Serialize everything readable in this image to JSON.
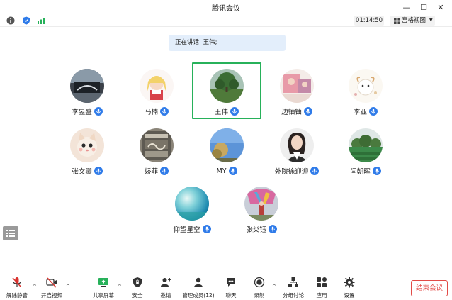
{
  "window": {
    "title": "腾讯会议",
    "controls": {
      "minimize": "—",
      "maximize": "☐",
      "close": "✕"
    }
  },
  "statusbar": {
    "icons": [
      "info-icon",
      "shield-icon",
      "signal-icon"
    ],
    "timer": "01:14:50",
    "view_label": "宫格视图",
    "accent_color": "#2f7be9",
    "signal_color": "#27b15a"
  },
  "speaker_banner": "正在讲话: 王伟;",
  "participants": [
    {
      "name": "李昱盛",
      "avatar": "dark-reflection",
      "active": false
    },
    {
      "name": "马楠",
      "avatar": "anime-girl",
      "active": false
    },
    {
      "name": "王伟",
      "avatar": "tree-field",
      "active": true
    },
    {
      "name": "边铀铀",
      "avatar": "couple-photo",
      "active": false
    },
    {
      "name": "李亚",
      "avatar": "cartoon-sheep",
      "active": false
    },
    {
      "name": "张文卿",
      "avatar": "kitten",
      "active": false
    },
    {
      "name": "娇菲",
      "avatar": "coffee-wine-sign",
      "active": false
    },
    {
      "name": "MY",
      "avatar": "blue-sky-tree",
      "active": false
    },
    {
      "name": "外院徐迎迎",
      "avatar": "woman-portrait",
      "active": false
    },
    {
      "name": "闫朝晖",
      "avatar": "green-landscape",
      "active": false
    },
    {
      "name": "仰望星空",
      "avatar": "teal-gradient",
      "active": false
    },
    {
      "name": "张炎钰",
      "avatar": "colorful-outdoor",
      "active": false
    }
  ],
  "toolbar": {
    "unmute": "解除静音",
    "start_video": "开启视频",
    "share_screen": "共享屏幕",
    "security": "安全",
    "invite": "邀请",
    "manage_members": "管理成员(12)",
    "chat": "聊天",
    "record": "录制",
    "breakout": "分组讨论",
    "apps": "应用",
    "settings": "设置",
    "end_meeting": "结束会议"
  },
  "colors": {
    "active_border": "#27b15a",
    "end_button": "#e24b47",
    "muted_red": "#d9312d",
    "banner_bg": "#e3eefb"
  }
}
